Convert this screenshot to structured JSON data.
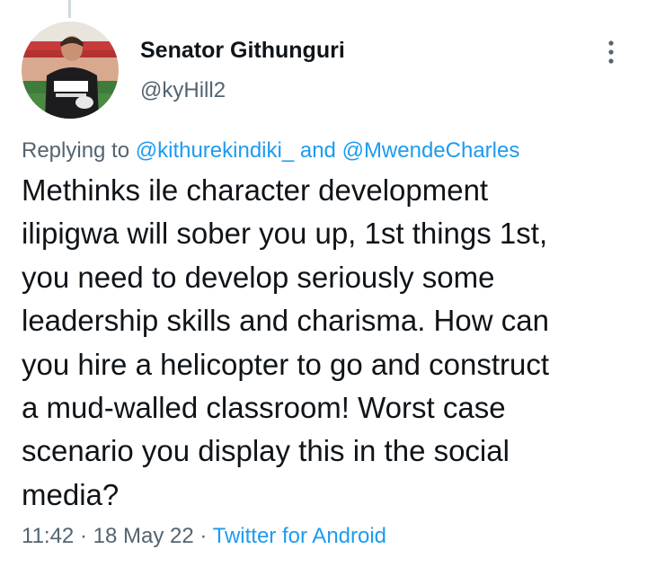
{
  "tweet": {
    "author_name": "Senator Githunguri",
    "author_handle": "@kyHill2",
    "reply": {
      "prefix": "Replying to",
      "mention_1": "@kithurekindiki_",
      "conjunction": "and",
      "mention_2": "@MwendeCharles"
    },
    "text_lines": [
      "Methinks ile character development",
      "ilipigwa will sober you up, 1st things 1st,",
      "you need to develop seriously some",
      "leadership skills and charisma. How can",
      "you hire a helicopter to go and construct",
      "a mud-walled classroom! Worst case",
      "scenario you display this in the social",
      "media?"
    ],
    "time": "11:42",
    "date": "18 May 22",
    "separator": "·",
    "source": "Twitter for Android"
  },
  "icons": {
    "more": "more-vertical-icon",
    "avatar": "profile-avatar"
  },
  "colors": {
    "text": "#0f1419",
    "muted": "#536471",
    "link": "#1d9bf0",
    "thread_line": "#cfd9de"
  }
}
